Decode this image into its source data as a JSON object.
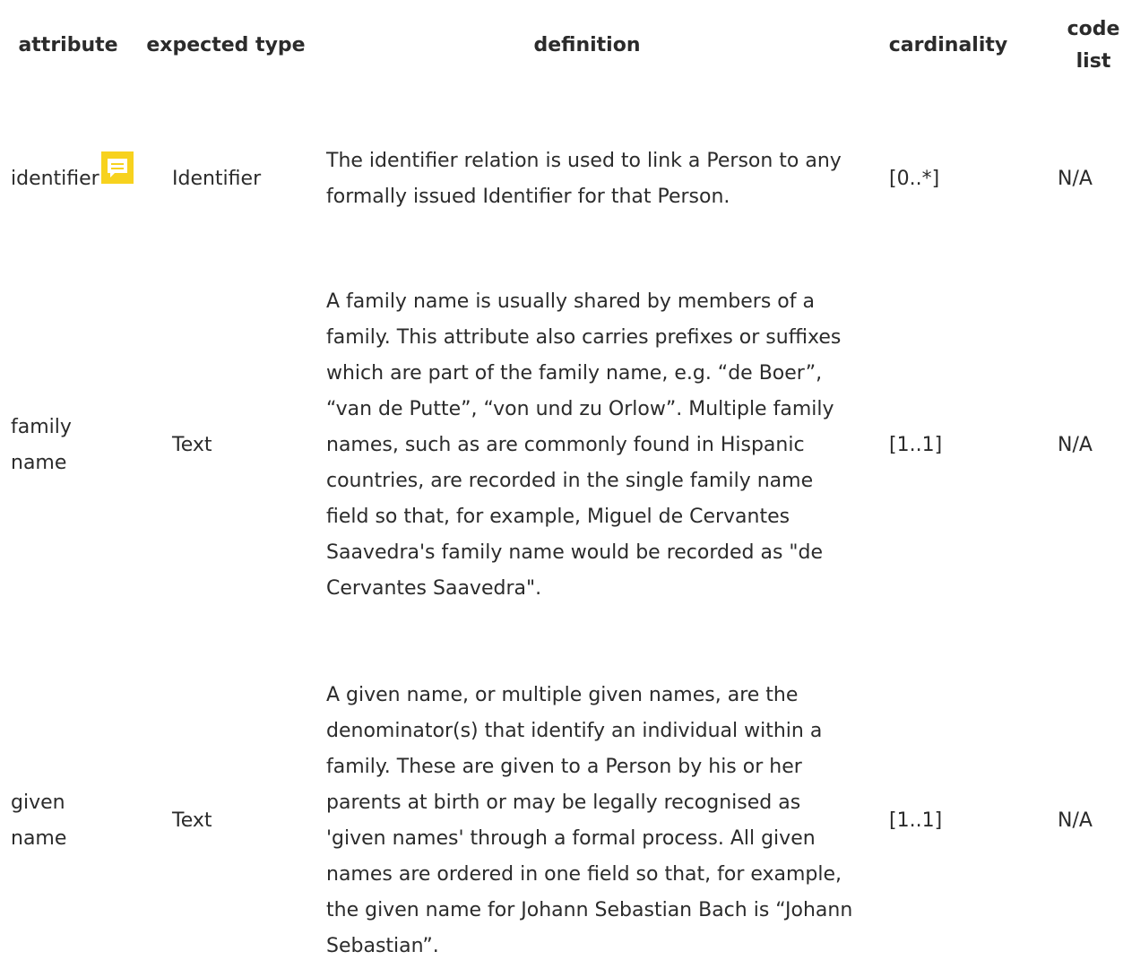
{
  "header": {
    "attribute": "attribute",
    "expected_type": "expected type",
    "definition": "definition",
    "cardinality": "cardinality",
    "code_list": "code list"
  },
  "rows": [
    {
      "attribute": "identifier",
      "expected_type": "Identifier",
      "definition": "The identifier relation is used to link a Person to any formally issued Identifier for that Person.",
      "cardinality": "[0..*]",
      "code_list": "N/A",
      "icon": "comment-icon"
    },
    {
      "attribute": "family name",
      "expected_type": "Text",
      "definition": "A family name is usually shared by members of a family. This attribute also carries prefixes or suffixes which are part of the family name, e.g. “de Boer”, “van de Putte”, “von und zu Orlow”. Multiple family names, such as are commonly found in Hispanic countries, are recorded in the single family name field so that, for example, Miguel de Cervantes Saavedra's family name would be recorded as \"de Cervantes Saavedra\".",
      "cardinality": "[1..1]",
      "code_list": "N/A"
    },
    {
      "attribute": "given name",
      "expected_type": "Text",
      "definition": "A given name, or multiple given names, are the denominator(s) that identify an individual within a family. These are given to a Person by his or her parents at birth or may be legally recognised as 'given names' through a formal process. All given names are ordered in one field so that, for example, the given name for Johann Sebastian Bach is “Johann Sebastian”.",
      "cardinality": "[1..1]",
      "code_list": "N/A"
    }
  ],
  "colors": {
    "comment_icon_bg": "#f7d21e",
    "text": "#2b2b2b"
  }
}
